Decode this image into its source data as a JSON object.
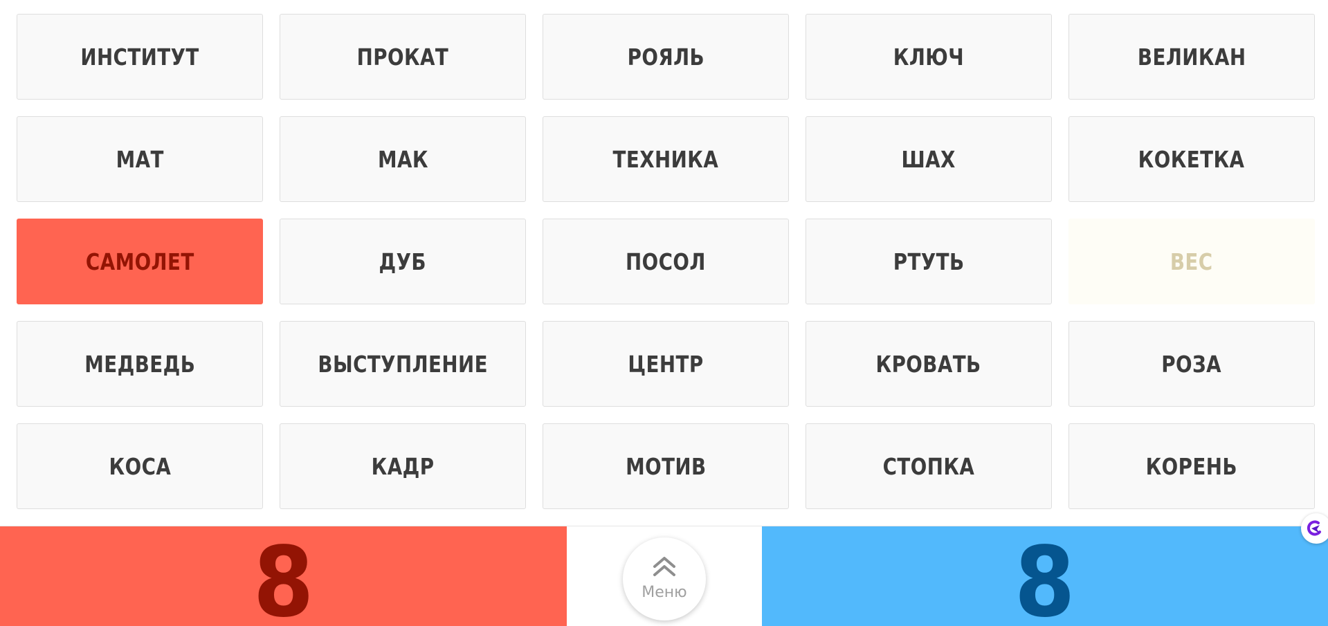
{
  "cards": [
    {
      "word": "ИНСТИТУТ",
      "state": "unrevealed"
    },
    {
      "word": "ПРОКАТ",
      "state": "unrevealed"
    },
    {
      "word": "РОЯЛЬ",
      "state": "unrevealed"
    },
    {
      "word": "КЛЮЧ",
      "state": "unrevealed"
    },
    {
      "word": "ВЕЛИКАН",
      "state": "unrevealed"
    },
    {
      "word": "МАТ",
      "state": "unrevealed"
    },
    {
      "word": "МАК",
      "state": "unrevealed"
    },
    {
      "word": "ТЕХНИКА",
      "state": "unrevealed"
    },
    {
      "word": "ШАХ",
      "state": "unrevealed"
    },
    {
      "word": "КОКЕТКА",
      "state": "unrevealed"
    },
    {
      "word": "САМОЛЕТ",
      "state": "red"
    },
    {
      "word": "ДУБ",
      "state": "unrevealed"
    },
    {
      "word": "ПОСОЛ",
      "state": "unrevealed"
    },
    {
      "word": "РТУТЬ",
      "state": "unrevealed"
    },
    {
      "word": "ВЕС",
      "state": "neutral"
    },
    {
      "word": "МЕДВЕДЬ",
      "state": "unrevealed"
    },
    {
      "word": "ВЫСТУПЛЕНИЕ",
      "state": "unrevealed"
    },
    {
      "word": "ЦЕНТР",
      "state": "unrevealed"
    },
    {
      "word": "КРОВАТЬ",
      "state": "unrevealed"
    },
    {
      "word": "РОЗА",
      "state": "unrevealed"
    },
    {
      "word": "КОСА",
      "state": "unrevealed"
    },
    {
      "word": "КАДР",
      "state": "unrevealed"
    },
    {
      "word": "МОТИВ",
      "state": "unrevealed"
    },
    {
      "word": "СТОПКА",
      "state": "unrevealed"
    },
    {
      "word": "КОРЕНЬ",
      "state": "unrevealed"
    }
  ],
  "score": {
    "red": "8",
    "blue": "8"
  },
  "menu": {
    "label": "Меню",
    "icon": "double-chevron-up-icon"
  },
  "colors": {
    "red_team": "#ff6451",
    "red_text": "#931404",
    "blue_team": "#52b9fc",
    "blue_text": "#05558f",
    "neutral_card": "#fefdf6",
    "neutral_text": "#d7cda9",
    "card_bg": "#f9f9f9",
    "card_text": "#3c3c3c"
  }
}
